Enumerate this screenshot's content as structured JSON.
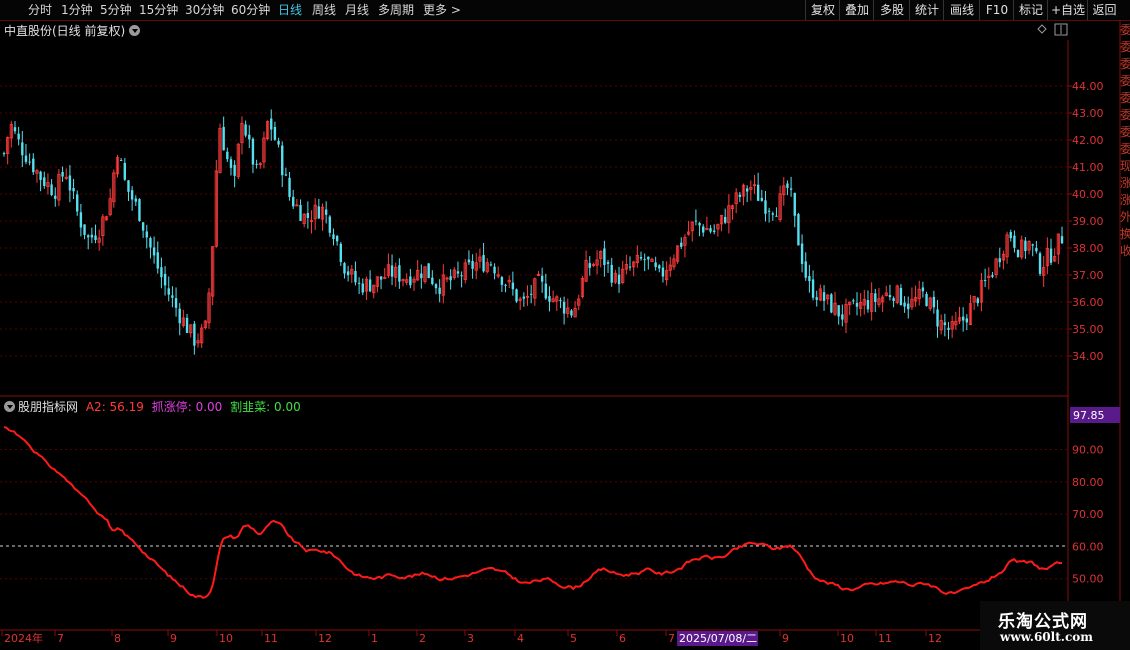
{
  "toolbar": {
    "periods": [
      "分时",
      "1分钟",
      "5分钟",
      "15分钟",
      "30分钟",
      "60分钟",
      "日线",
      "周线",
      "月线",
      "多周期",
      "更多 >"
    ],
    "active_period": "日线",
    "right_buttons": [
      "复权",
      "叠加",
      "多股",
      "统计",
      "画线",
      "F10",
      "标记",
      "+自选",
      "返回"
    ]
  },
  "main_chart": {
    "title": "中直股份(日线 前复权)",
    "y_ticks": [
      "44.00",
      "43.00",
      "42.00",
      "41.00",
      "40.00",
      "39.00",
      "38.00",
      "37.00",
      "36.00",
      "35.00",
      "34.00"
    ]
  },
  "indicator": {
    "name": "股朋指标网",
    "a2_label": "A2: 56.19",
    "zhua_label": "抓涨停: 0.00",
    "ge_label": "割韭菜: 0.00",
    "current_value": "97.85",
    "y_ticks": [
      "90.00",
      "80.00",
      "70.00",
      "60.00",
      "50.00"
    ]
  },
  "time_axis": {
    "labels": [
      "2024年",
      "7",
      "8",
      "9",
      "10",
      "11",
      "12",
      "1",
      "2",
      "3",
      "4",
      "5",
      "6",
      "7",
      "8",
      "9",
      "10",
      "11",
      "12"
    ],
    "cursor_date": "2025/07/08/二"
  },
  "watermark": {
    "line1": "乐淘公式网",
    "line2": "www.60lt.com"
  },
  "colors": {
    "up": "#ff3b3b",
    "down": "#54e0f0",
    "indicator_line": "#ff1a1a",
    "grid": "#6a0000",
    "active_tab": "#3ec6e6"
  },
  "chart_data": {
    "type": "candlestick",
    "title": "中直股份(日线 前复权)",
    "y_range": [
      33.3,
      45.8
    ],
    "close_path_x_fraction": [
      0,
      0.006,
      0.015,
      0.025,
      0.035,
      0.048,
      0.058,
      0.07,
      0.08,
      0.09,
      0.1,
      0.107,
      0.115,
      0.128,
      0.14,
      0.152,
      0.165,
      0.18,
      0.19,
      0.196,
      0.203,
      0.212,
      0.218,
      0.225,
      0.232,
      0.24,
      0.25,
      0.258,
      0.27,
      0.285,
      0.3,
      0.312,
      0.322,
      0.335,
      0.35,
      0.365,
      0.38,
      0.398,
      0.41,
      0.428,
      0.445,
      0.46,
      0.475,
      0.49,
      0.505,
      0.52,
      0.538,
      0.55,
      0.565,
      0.578,
      0.59,
      0.605,
      0.62,
      0.635,
      0.652,
      0.672,
      0.69,
      0.705,
      0.72,
      0.73,
      0.742,
      0.748,
      0.76,
      0.775,
      0.792,
      0.81,
      0.826,
      0.84,
      0.856,
      0.87,
      0.883,
      0.895,
      0.908,
      0.92,
      0.935,
      0.95,
      0.96,
      0.97,
      0.978,
      0.99,
      1
    ],
    "close_path": [
      41.5,
      42.6,
      41.8,
      41.2,
      40.6,
      40.1,
      40.9,
      39.2,
      38.3,
      38.7,
      39.7,
      41.7,
      40.3,
      39.3,
      37.8,
      36.6,
      35.6,
      34.6,
      34.9,
      37.2,
      42.7,
      41.1,
      40.4,
      42.9,
      41.7,
      40.6,
      42.8,
      41.8,
      39.9,
      39.1,
      39.5,
      38.6,
      37.3,
      36.6,
      36.7,
      37.1,
      36.9,
      37.2,
      36.6,
      36.9,
      37.4,
      37.5,
      36.7,
      35.9,
      36.7,
      36.1,
      35.6,
      37.2,
      37.7,
      36.8,
      37.2,
      37.6,
      36.9,
      37.9,
      38.9,
      38.6,
      39.7,
      40.3,
      39.6,
      39.5,
      40.3,
      38.8,
      36.6,
      36.1,
      35.5,
      35.9,
      36.1,
      36.4,
      35.9,
      36.3,
      35.3,
      34.9,
      35.4,
      36.2,
      37.2,
      38.6,
      37.9,
      38.2,
      37.3,
      37.8,
      38.4
    ],
    "y_ticks": [
      44,
      43,
      42,
      41,
      40,
      39,
      38,
      37,
      36,
      35,
      34
    ]
  }
}
